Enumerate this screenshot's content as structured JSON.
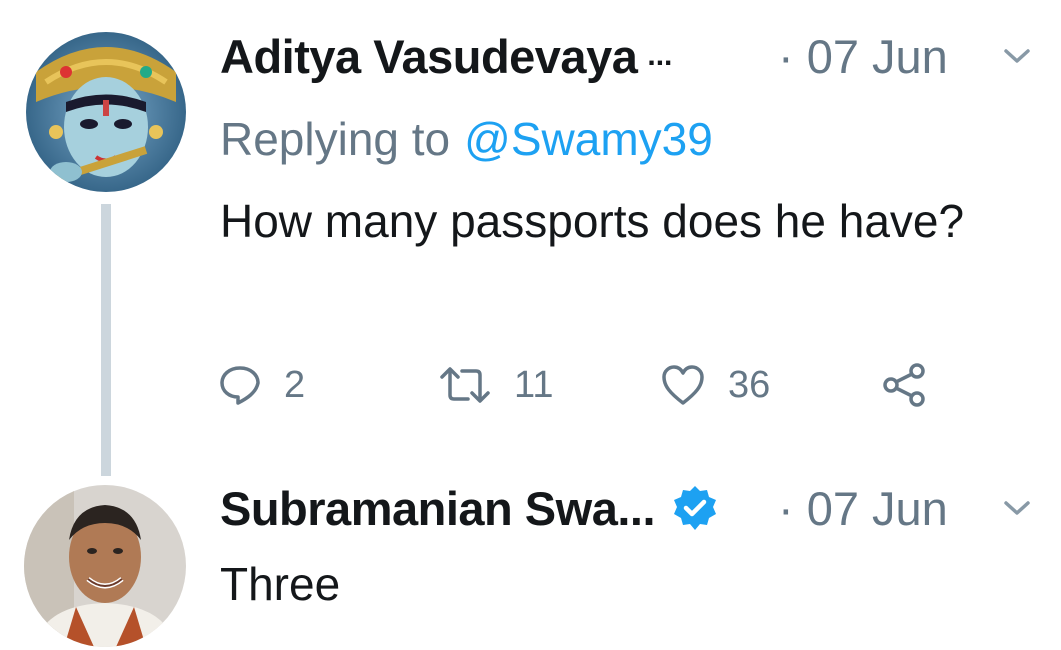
{
  "tweets": [
    {
      "author": "Aditya Vasudevaya",
      "ellipsis": "...",
      "date": "· 07 Jun",
      "replying_label": "Replying to",
      "replying_handle": "@Swamy39",
      "text": "How many passports does he have?",
      "actions": {
        "reply_count": "2",
        "retweet_count": "11",
        "like_count": "36"
      }
    },
    {
      "author": "Subramanian Swa...",
      "verified": true,
      "date": "· 07 Jun",
      "text": "Three"
    }
  ],
  "icons": {
    "reply": "speech-bubble-icon",
    "retweet": "retweet-arrows-icon",
    "like": "heart-icon",
    "share": "share-nodes-icon",
    "more": "chevron-down-icon",
    "verified": "verified-badge-icon"
  },
  "colors": {
    "name": "#14171a",
    "muted": "#657786",
    "link": "#1da1f2",
    "thread_line": "#ccd6dd",
    "verified": "#1da1f2"
  }
}
